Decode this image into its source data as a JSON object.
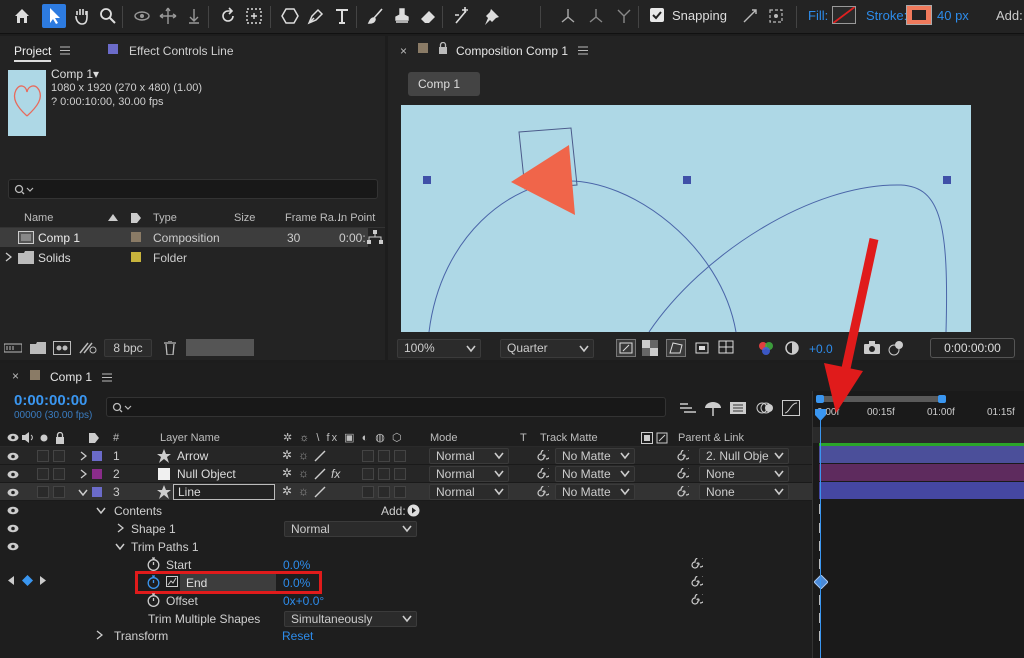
{
  "toolbar": {
    "snapping_label": "Snapping",
    "fill_label": "Fill:",
    "stroke_label": "Stroke:",
    "stroke_width": "40 px",
    "add_label": "Add:",
    "tools": [
      "home-icon",
      "selection-icon",
      "hand-icon",
      "zoom-icon",
      "orbit-icon",
      "pan-icon",
      "dolly-icon",
      "rotate-icon",
      "pan-behind-icon",
      "shape-icon",
      "pen-icon",
      "type-icon",
      "brush-icon",
      "clone-stamp-icon",
      "eraser-icon",
      "roto-brush-icon",
      "puppet-pin-icon"
    ]
  },
  "project": {
    "tab_label": "Project",
    "effect_controls_label": "Effect Controls Line",
    "comp_name": "Comp 1▾",
    "comp_dims": "1080 x 1920  (270 x 480) (1.00)",
    "comp_duration": "? 0:00:10:00, 30.00 fps",
    "columns": {
      "name": "Name",
      "type": "Type",
      "size": "Size",
      "frame_rate": "Frame Ra...",
      "in_point": "In Point"
    },
    "items": [
      {
        "name": "Comp 1",
        "type": "Composition",
        "size": "",
        "frame_rate": "30",
        "in_point": "0:00:",
        "color": "#8a7b66"
      },
      {
        "name": "Solids",
        "type": "Folder",
        "size": "",
        "frame_rate": "",
        "in_point": "",
        "color": "#c8b43c"
      }
    ],
    "bpc_label": "8 bpc"
  },
  "composition": {
    "tab_label": "Composition Comp 1",
    "flow_tab": "Comp 1",
    "zoom": "100%",
    "resolution": "Quarter",
    "exposure": "+0.0",
    "timecode": "0:00:00:00",
    "bg_color": "#aed8e6"
  },
  "timeline": {
    "tab_label": "Comp 1",
    "timecode": "0:00:00:00",
    "fps_label": "00000 (30.00 fps)",
    "ruler": [
      "0:00f",
      "00:15f",
      "01:00f",
      "01:15f"
    ],
    "columns": {
      "num": "#",
      "layer_name": "Layer Name",
      "mode": "Mode",
      "t": "T",
      "track_matte": "Track Matte",
      "parent": "Parent & Link"
    },
    "layers": [
      {
        "num": "1",
        "name": "Arrow",
        "mode": "Normal",
        "matte": "No Matte",
        "parent": "2. Null Obje",
        "color": "#6b6bc9",
        "bar": "#4b4f9a"
      },
      {
        "num": "2",
        "name": "Null Object",
        "mode": "Normal",
        "matte": "No Matte",
        "parent": "None",
        "color": "#8a2c8a",
        "bar": "#5e2b5e"
      },
      {
        "num": "3",
        "name": "Line",
        "mode": "Normal",
        "matte": "No Matte",
        "parent": "None",
        "color": "#6b6bc9",
        "bar": "#4547a2"
      }
    ],
    "contents_label": "Contents",
    "add_label": "Add:",
    "shape_label": "Shape 1",
    "shape_mode": "Normal",
    "trim_label": "Trim Paths 1",
    "start_label": "Start",
    "start_value": "0.0%",
    "end_label": "End",
    "end_value": "0.0%",
    "offset_label": "Offset",
    "offset_value": "0x+0.0°",
    "trim_multiple_label": "Trim Multiple Shapes",
    "trim_multiple_value": "Simultaneously",
    "transform_label": "Transform",
    "reset_label": "Reset"
  },
  "colors": {
    "accent": "#2d8ceb",
    "highlight": "#e01b1b",
    "green": "#2aa52a"
  }
}
